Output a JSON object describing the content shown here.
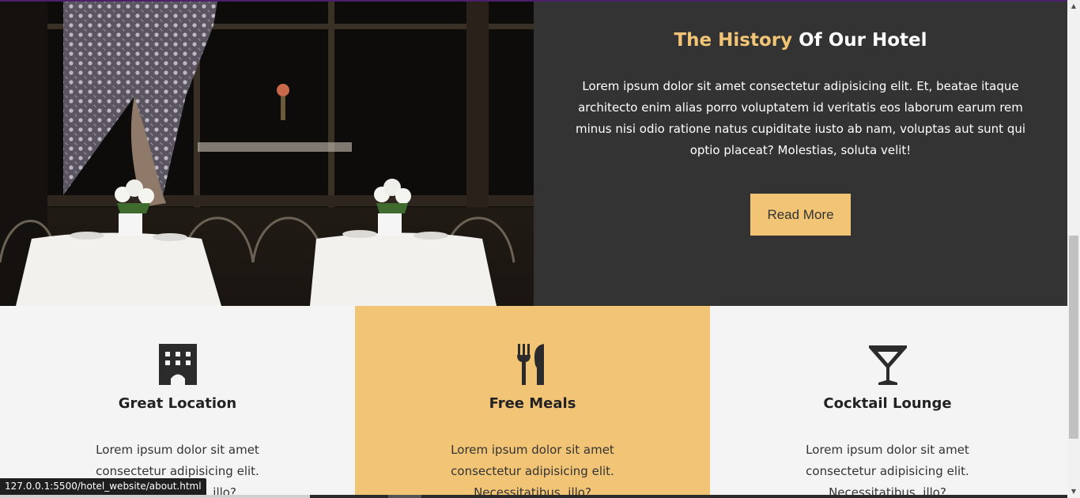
{
  "history": {
    "title_accent": "The History",
    "title_rest": "Of Our Hotel",
    "body": "Lorem ipsum dolor sit amet consectetur adipisicing elit. Et, beatae itaque architecto enim alias porro voluptatem id veritatis eos laborum earum rem minus nisi odio ratione natus cupiditate iusto ab nam, voluptas aut sunt qui optio placeat? Molestias, soluta velit!",
    "button_label": "Read More"
  },
  "features": [
    {
      "icon": "hotel-icon",
      "title": "Great Location",
      "text": "Lorem ipsum dolor sit amet consectetur adipisicing elit. Necessitatibus, illo?"
    },
    {
      "icon": "utensils-icon",
      "title": "Free Meals",
      "text": "Lorem ipsum dolor sit amet consectetur adipisicing elit. Necessitatibus, illo?"
    },
    {
      "icon": "cocktail-icon",
      "title": "Cocktail Lounge",
      "text": "Lorem ipsum dolor sit amet consectetur adipisicing elit. Necessitatibus, illo?"
    }
  ],
  "status_bar": {
    "url": "127.0.0.1:5500/hotel_website/about.html"
  },
  "scrollbar": {
    "up_arrow": "▲",
    "down_arrow": "▼"
  },
  "colors": {
    "accent": "#f2c476",
    "dark": "#333333",
    "light": "#f4f4f4"
  }
}
